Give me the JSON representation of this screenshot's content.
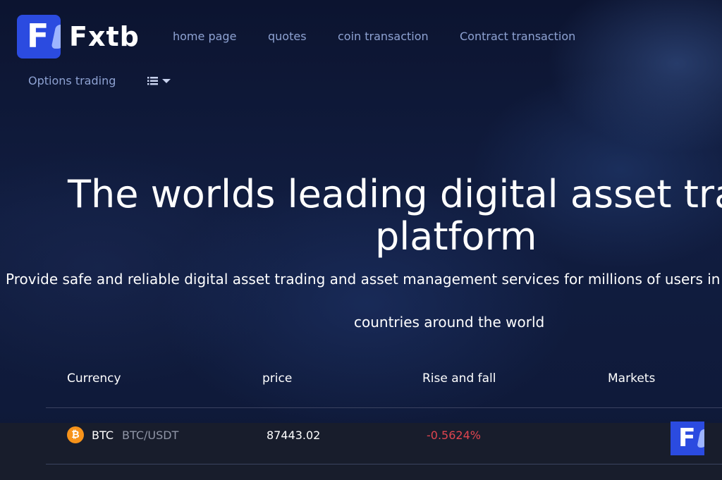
{
  "brand": {
    "name": "Fxtb",
    "mark_letter": "F",
    "accent_color": "#2b4be0"
  },
  "nav": {
    "items": [
      {
        "label": "home page"
      },
      {
        "label": "quotes"
      },
      {
        "label": "coin transaction"
      },
      {
        "label": "Contract transaction"
      },
      {
        "label": "Options trading"
      }
    ],
    "menu_icon": "list-dropdown-icon"
  },
  "hero": {
    "title_line1": "The worlds leading digital asset trading",
    "title_line2": "platform",
    "subtitle_line1": "Provide safe and reliable digital asset trading and asset management services for millions of users in",
    "subtitle_line2": "countries around the world"
  },
  "market_table": {
    "headers": [
      "Currency",
      "price",
      "Rise and fall",
      "Markets"
    ],
    "rows": [
      {
        "coin_icon": "bitcoin-icon",
        "coin_glyph": "₿",
        "symbol": "BTC",
        "pair": "BTC/USDT",
        "price": "87443.02",
        "change": "-0.5624%",
        "change_color": "#e0454f"
      }
    ]
  },
  "floating_badge": {
    "mark_letter": "F"
  }
}
